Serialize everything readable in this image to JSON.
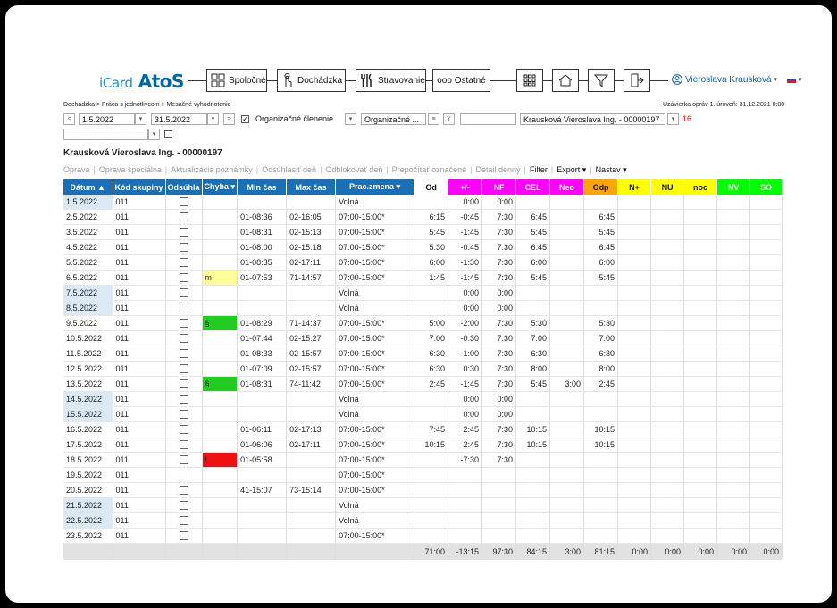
{
  "logo": {
    "icard": "iCard",
    "atos": "AtoS"
  },
  "nav": {
    "spolocne": "Spoločné",
    "dochadzka": "Dochádzka",
    "stravovanie": "Stravovanie",
    "ostatne": "ooo Ostatné"
  },
  "user": {
    "name": "Vieroslava Krausková"
  },
  "breadcrumb": "Dochádzka > Práca s jednotlivcom > Mesačné vyhodnotenie",
  "uzavierka": "Uzávierka opráv 1. úroveň: 31.12.2021 0:00",
  "filters": {
    "date_from": "1.5.2022",
    "date_to": "31.5.2022",
    "org_label": "Organizačné členenie",
    "org_value": "Organizačné ...",
    "employee": "Krausková Vieroslava Ing. - 00000197",
    "count": "16"
  },
  "person_title": "Krausková Vieroslava Ing. - 00000197",
  "toolbar": {
    "oprava": "Oprava",
    "oprava_spec": "Oprava špeciálna",
    "aktualizacia": "Aktualizácia poznámky",
    "odsuhlasit": "Odsúhlasiť deň",
    "odblokovat": "Odblokovať deň",
    "prepocitat": "Prepočítať označené",
    "detail": "Detail denný",
    "filter": "Filter",
    "export": "Export ▾",
    "nastav": "Nastav ▾"
  },
  "columns": [
    {
      "label": "Dátum ▲",
      "bg": "#1a6fb7",
      "color": "#ffffff"
    },
    {
      "label": "Kód skupiny",
      "bg": "#1a6fb7",
      "color": "#ffffff"
    },
    {
      "label": "Odsúhla",
      "bg": "#1a6fb7",
      "color": "#ffffff"
    },
    {
      "label": "Chyba ▾",
      "bg": "#1a6fb7",
      "color": "#ffffff"
    },
    {
      "label": "Min čas",
      "bg": "#1a6fb7",
      "color": "#ffffff"
    },
    {
      "label": "Max čas",
      "bg": "#1a6fb7",
      "color": "#ffffff"
    },
    {
      "label": "Prac.zmena ▾",
      "bg": "#1a6fb7",
      "color": "#ffffff"
    },
    {
      "label": "Od",
      "bg": "#ffffff",
      "color": "#111111"
    },
    {
      "label": "+/-",
      "bg": "#ff00ff",
      "color": "#ffffff"
    },
    {
      "label": "NF",
      "bg": "#ff00ff",
      "color": "#ffffff"
    },
    {
      "label": "CEL",
      "bg": "#ff00ff",
      "color": "#ffffff"
    },
    {
      "label": "Neo",
      "bg": "#ff00ff",
      "color": "#ffffff"
    },
    {
      "label": "Odp",
      "bg": "#ffa500",
      "color": "#111111"
    },
    {
      "label": "N+",
      "bg": "#ffff00",
      "color": "#111111"
    },
    {
      "label": "NU",
      "bg": "#ffff00",
      "color": "#111111"
    },
    {
      "label": "noc",
      "bg": "#ffff00",
      "color": "#111111"
    },
    {
      "label": "NV",
      "bg": "#00ff00",
      "color": "#ffffff"
    },
    {
      "label": "SO",
      "bg": "#00ff00",
      "color": "#ffffff"
    }
  ],
  "rows": [
    {
      "d": "1.5.2022",
      "wk": true,
      "k": "011",
      "ch": "",
      "chc": "",
      "min": "",
      "max": "",
      "pz": "Volná",
      "od": "",
      "pm": "0:00",
      "nf": "0:00",
      "cel": "",
      "neo": "",
      "odp": ""
    },
    {
      "d": "2.5.2022",
      "wk": false,
      "k": "011",
      "ch": "",
      "chc": "",
      "min": "01-08:36",
      "max": "02-16:05",
      "pz": "07:00-15:00*",
      "od": "6:15",
      "pm": "-0:45",
      "nf": "7:30",
      "cel": "6:45",
      "neo": "",
      "odp": "6:45"
    },
    {
      "d": "3.5.2022",
      "wk": false,
      "k": "011",
      "ch": "",
      "chc": "",
      "min": "01-08:31",
      "max": "02-15:13",
      "pz": "07:00-15:00*",
      "od": "5:45",
      "pm": "-1:45",
      "nf": "7:30",
      "cel": "5:45",
      "neo": "",
      "odp": "5:45"
    },
    {
      "d": "4.5.2022",
      "wk": false,
      "k": "011",
      "ch": "",
      "chc": "",
      "min": "01-08:00",
      "max": "02-15:18",
      "pz": "07:00-15:00*",
      "od": "5:30",
      "pm": "-0:45",
      "nf": "7:30",
      "cel": "6:45",
      "neo": "",
      "odp": "6:45"
    },
    {
      "d": "5.5.2022",
      "wk": false,
      "k": "011",
      "ch": "",
      "chc": "",
      "min": "01-08:35",
      "max": "02-17:11",
      "pz": "07:00-15:00*",
      "od": "6:00",
      "pm": "-1:30",
      "nf": "7:30",
      "cel": "6:00",
      "neo": "",
      "odp": "6:00"
    },
    {
      "d": "6.5.2022",
      "wk": false,
      "k": "011",
      "ch": "m",
      "chc": "#ffff99",
      "min": "01-07:53",
      "max": "71-14:57",
      "pz": "07:00-15:00*",
      "od": "1:45",
      "pm": "-1:45",
      "nf": "7:30",
      "cel": "5:45",
      "neo": "",
      "odp": "5:45"
    },
    {
      "d": "7.5.2022",
      "wk": true,
      "k": "011",
      "ch": "",
      "chc": "",
      "min": "",
      "max": "",
      "pz": "Volná",
      "od": "",
      "pm": "0:00",
      "nf": "0:00",
      "cel": "",
      "neo": "",
      "odp": ""
    },
    {
      "d": "8.5.2022",
      "wk": true,
      "k": "011",
      "ch": "",
      "chc": "",
      "min": "",
      "max": "",
      "pz": "Volná",
      "od": "",
      "pm": "0:00",
      "nf": "0:00",
      "cel": "",
      "neo": "",
      "odp": ""
    },
    {
      "d": "9.5.2022",
      "wk": false,
      "k": "011",
      "ch": "§",
      "chc": "#22cc22",
      "min": "01-08:29",
      "max": "71-14:37",
      "pz": "07:00-15:00*",
      "od": "5:00",
      "pm": "-2:00",
      "nf": "7:30",
      "cel": "5:30",
      "neo": "",
      "odp": "5:30"
    },
    {
      "d": "10.5.2022",
      "wk": false,
      "k": "011",
      "ch": "",
      "chc": "",
      "min": "01-07:44",
      "max": "02-15:27",
      "pz": "07:00-15:00*",
      "od": "7:00",
      "pm": "-0:30",
      "nf": "7:30",
      "cel": "7:00",
      "neo": "",
      "odp": "7:00"
    },
    {
      "d": "11.5.2022",
      "wk": false,
      "k": "011",
      "ch": "",
      "chc": "",
      "min": "01-08:33",
      "max": "02-15:57",
      "pz": "07:00-15:00*",
      "od": "6:30",
      "pm": "-1:00",
      "nf": "7:30",
      "cel": "6:30",
      "neo": "",
      "odp": "6:30"
    },
    {
      "d": "12.5.2022",
      "wk": false,
      "k": "011",
      "ch": "",
      "chc": "",
      "min": "01-07:09",
      "max": "02-15:57",
      "pz": "07:00-15:00*",
      "od": "6:30",
      "pm": "0:30",
      "nf": "7:30",
      "cel": "8:00",
      "neo": "",
      "odp": "8:00"
    },
    {
      "d": "13.5.2022",
      "wk": false,
      "k": "011",
      "ch": "§",
      "chc": "#22cc22",
      "min": "01-08:31",
      "max": "74-11:42",
      "pz": "07:00-15:00*",
      "od": "2:45",
      "pm": "-1:45",
      "nf": "7:30",
      "cel": "5:45",
      "neo": "3:00",
      "odp": "2:45"
    },
    {
      "d": "14.5.2022",
      "wk": true,
      "k": "011",
      "ch": "",
      "chc": "",
      "min": "",
      "max": "",
      "pz": "Volná",
      "od": "",
      "pm": "0:00",
      "nf": "0:00",
      "cel": "",
      "neo": "",
      "odp": ""
    },
    {
      "d": "15.5.2022",
      "wk": true,
      "k": "011",
      "ch": "",
      "chc": "",
      "min": "",
      "max": "",
      "pz": "Volná",
      "od": "",
      "pm": "0:00",
      "nf": "0:00",
      "cel": "",
      "neo": "",
      "odp": ""
    },
    {
      "d": "16.5.2022",
      "wk": false,
      "k": "011",
      "ch": "",
      "chc": "",
      "min": "01-06:11",
      "max": "02-17:13",
      "pz": "07:00-15:00*",
      "od": "7:45",
      "pm": "2:45",
      "nf": "7:30",
      "cel": "10:15",
      "neo": "",
      "odp": "10:15"
    },
    {
      "d": "17.5.2022",
      "wk": false,
      "k": "011",
      "ch": "",
      "chc": "",
      "min": "01-06:06",
      "max": "02-17:11",
      "pz": "07:00-15:00*",
      "od": "10:15",
      "pm": "2:45",
      "nf": "7:30",
      "cel": "10:15",
      "neo": "",
      "odp": "10:15"
    },
    {
      "d": "18.5.2022",
      "wk": false,
      "k": "011",
      "ch": "!",
      "chc": "#ee1111",
      "min": "01-05:58",
      "max": "",
      "pz": "07:00-15:00*",
      "od": "",
      "pm": "-7:30",
      "nf": "7:30",
      "cel": "",
      "neo": "",
      "odp": ""
    },
    {
      "d": "19.5.2022",
      "wk": false,
      "k": "011",
      "ch": "",
      "chc": "",
      "min": "",
      "max": "",
      "pz": "07:00-15:00*",
      "od": "",
      "pm": "",
      "nf": "",
      "cel": "",
      "neo": "",
      "odp": ""
    },
    {
      "d": "20.5.2022",
      "wk": false,
      "k": "011",
      "ch": "",
      "chc": "",
      "min": "41-15:07",
      "max": "73-15:14",
      "pz": "07:00-15:00*",
      "od": "",
      "pm": "",
      "nf": "",
      "cel": "",
      "neo": "",
      "odp": ""
    },
    {
      "d": "21.5.2022",
      "wk": true,
      "k": "011",
      "ch": "",
      "chc": "",
      "min": "",
      "max": "",
      "pz": "Volná",
      "od": "",
      "pm": "",
      "nf": "",
      "cel": "",
      "neo": "",
      "odp": ""
    },
    {
      "d": "22.5.2022",
      "wk": true,
      "k": "011",
      "ch": "",
      "chc": "",
      "min": "",
      "max": "",
      "pz": "Volná",
      "od": "",
      "pm": "",
      "nf": "",
      "cel": "",
      "neo": "",
      "odp": ""
    },
    {
      "d": "23.5.2022",
      "wk": false,
      "k": "011",
      "ch": "",
      "chc": "",
      "min": "",
      "max": "",
      "pz": "07:00-15:00*",
      "od": "",
      "pm": "",
      "nf": "",
      "cel": "",
      "neo": "",
      "odp": ""
    }
  ],
  "totals": {
    "od": "71:00",
    "pm": "-13:15",
    "nf": "97:30",
    "cel": "84:15",
    "neo": "3:00",
    "odp": "81:15",
    "np": "0:00",
    "nu": "0:00",
    "noc": "0:00",
    "nv": "0:00",
    "so": "0:00"
  }
}
